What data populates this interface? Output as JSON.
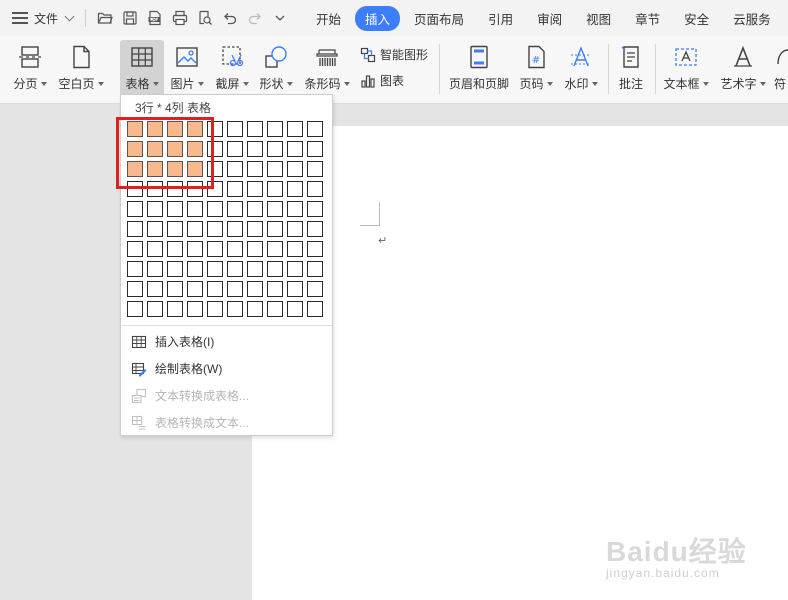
{
  "menubar": {
    "file_label": "文件",
    "tabs": [
      {
        "label": "开始",
        "active": false
      },
      {
        "label": "插入",
        "active": true
      },
      {
        "label": "页面布局",
        "active": false
      },
      {
        "label": "引用",
        "active": false
      },
      {
        "label": "审阅",
        "active": false
      },
      {
        "label": "视图",
        "active": false
      },
      {
        "label": "章节",
        "active": false
      },
      {
        "label": "安全",
        "active": false
      },
      {
        "label": "云服务",
        "active": false
      }
    ],
    "accent": "#3d7dff"
  },
  "ribbon": {
    "page_break": "分页",
    "blank_page": "空白页",
    "table": "表格",
    "picture": "图片",
    "screenshot": "截屏",
    "shape": "形状",
    "barcode": "条形码",
    "smart_art": "智能图形",
    "chart": "图表",
    "header_footer": "页眉和页脚",
    "page_number": "页码",
    "watermark": "水印",
    "comment": "批注",
    "text_box": "文本框",
    "word_art": "艺术字",
    "symbol": "符"
  },
  "table_dropdown": {
    "size_label": "3行 * 4列 表格",
    "grid_rows": 10,
    "grid_cols": 10,
    "selected_rows": 3,
    "selected_cols": 4,
    "selection_color": "#f8b98c",
    "highlight_color": "#e02020",
    "items": [
      {
        "label": "插入表格(I)",
        "enabled": true
      },
      {
        "label": "绘制表格(W)",
        "enabled": true
      },
      {
        "label": "文本转换成表格...",
        "enabled": false
      },
      {
        "label": "表格转换成文本...",
        "enabled": false
      }
    ]
  },
  "document": {
    "paragraph_mark": "↵"
  },
  "watermark": {
    "brand": "Baidu经验",
    "url": "jingyan.baidu.com"
  }
}
